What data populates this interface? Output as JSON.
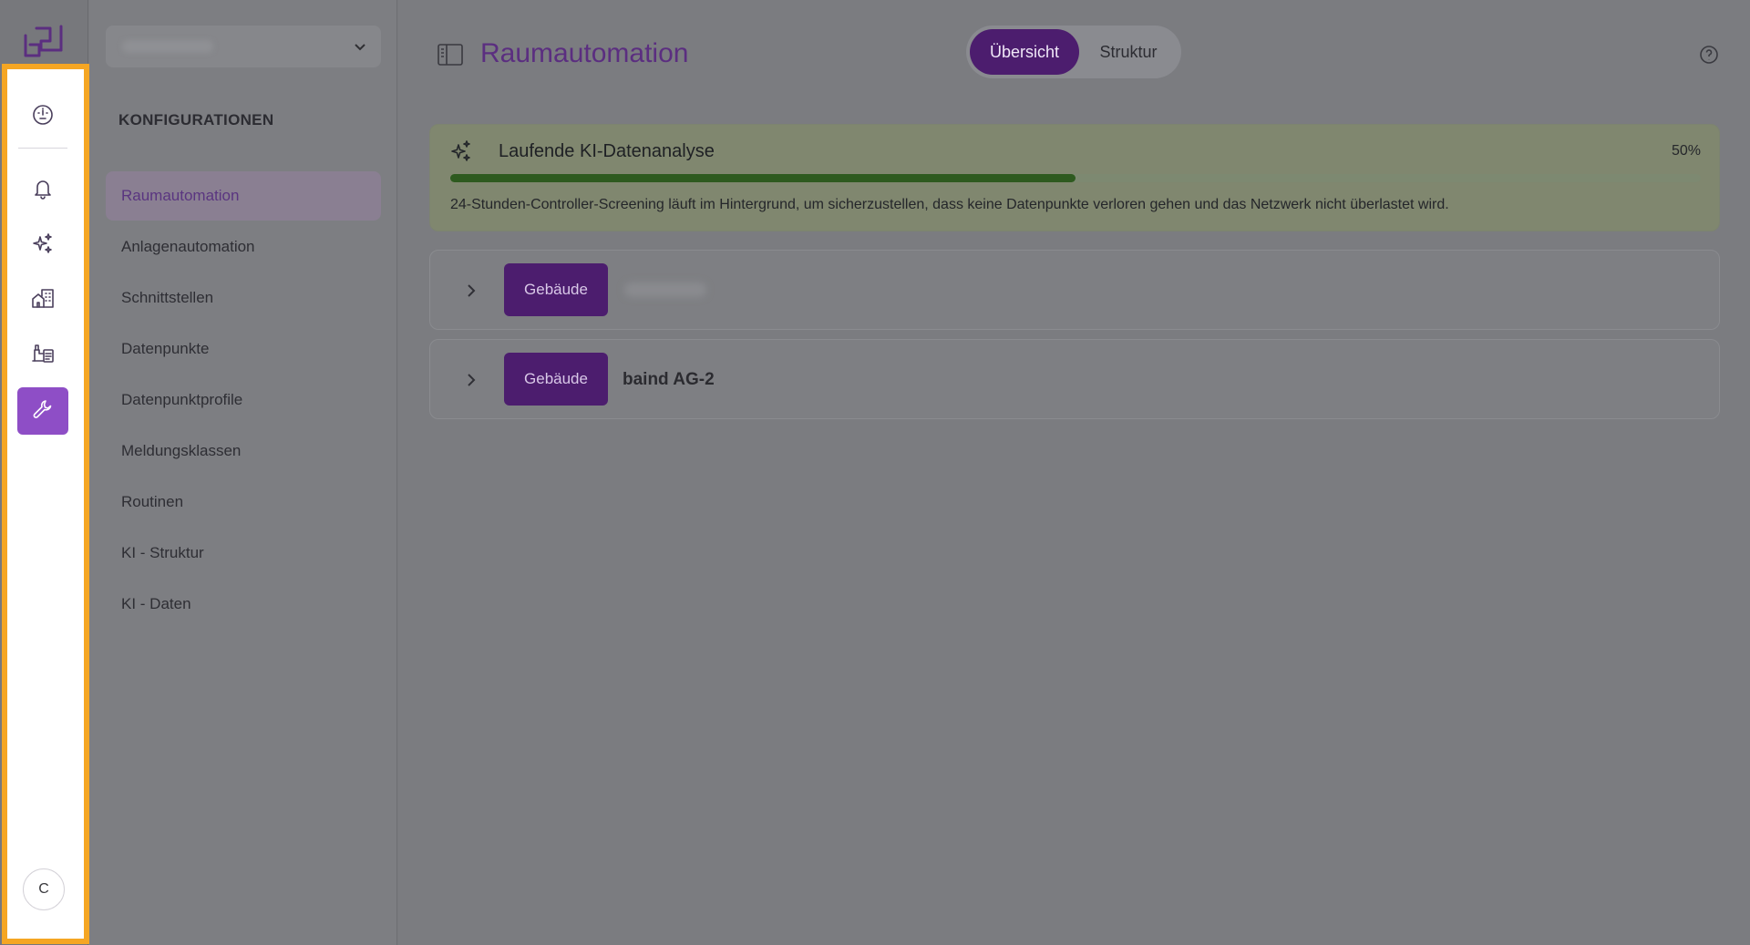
{
  "rail": {
    "items": [
      {
        "icon": "dashboard-gauge-icon"
      },
      {
        "icon": "bell-icon"
      },
      {
        "icon": "sparkles-icon"
      },
      {
        "icon": "buildings-icon"
      },
      {
        "icon": "plant-documents-icon"
      },
      {
        "icon": "wrench-icon"
      }
    ],
    "active_index": 5,
    "avatar_initial": "C"
  },
  "sidebar": {
    "section_title": "KONFIGURATIONEN",
    "items": [
      {
        "label": "Raumautomation"
      },
      {
        "label": "Anlagenautomation"
      },
      {
        "label": "Schnittstellen"
      },
      {
        "label": "Datenpunkte"
      },
      {
        "label": "Datenpunktprofile"
      },
      {
        "label": "Meldungsklassen"
      },
      {
        "label": "Routinen"
      },
      {
        "label": "KI - Struktur"
      },
      {
        "label": "KI - Daten"
      }
    ],
    "active_index": 0
  },
  "header": {
    "title": "Raumautomation",
    "tabs": [
      {
        "label": "Übersicht"
      },
      {
        "label": "Struktur"
      }
    ],
    "active_tab": 0
  },
  "ai_analysis": {
    "title": "Laufende KI-Datenanalyse",
    "percent_label": "50%",
    "progress": 0.5,
    "description": "24-Stunden-Controller-Screening läuft im Hintergrund, um sicherzustellen, dass keine Datenpunkte verloren gehen und das Netzwerk nicht überlastet wird."
  },
  "buildings": [
    {
      "badge": "Gebäude",
      "name": ""
    },
    {
      "badge": "Gebäude",
      "name": "baind AG-2"
    }
  ],
  "colors": {
    "accent": "#8e4ec6",
    "title": "#5b2e80",
    "badge": "#4c1d6e",
    "progress": "#2e5a1f",
    "highlight_border": "#f5a623"
  }
}
